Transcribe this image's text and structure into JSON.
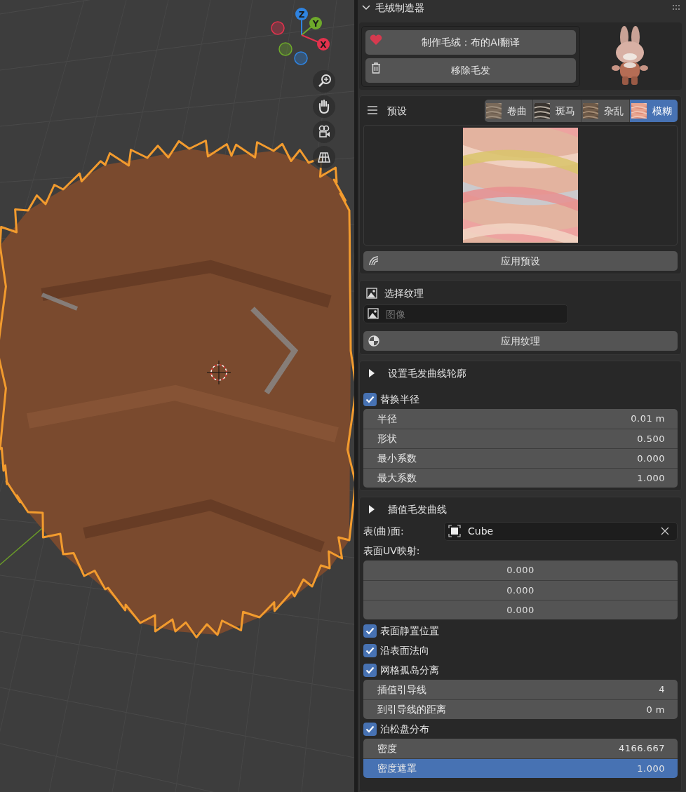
{
  "viewport": {
    "axes": [
      {
        "label": "Z",
        "kind": "z"
      },
      {
        "label": "Y",
        "kind": "y"
      },
      {
        "label": "X",
        "kind": "x"
      }
    ]
  },
  "panel": {
    "title": "毛绒制造器",
    "expanded": true
  },
  "actions": [
    {
      "label": "制作毛绒：布的AI翻译"
    },
    {
      "label": "移除毛发"
    }
  ],
  "presets": {
    "label": "预设",
    "tabs": [
      {
        "label": "卷曲",
        "selected": false
      },
      {
        "label": "斑马",
        "selected": false
      },
      {
        "label": "杂乱",
        "selected": false
      },
      {
        "label": "模糊",
        "selected": true
      }
    ],
    "apply_label": "应用预设"
  },
  "texture": {
    "label": "选择纹理",
    "image_placeholder": "图像",
    "apply_label": "应用纹理"
  },
  "profile": {
    "title": "设置毛发曲线轮廓",
    "expanded": false,
    "replace_radius": {
      "label": "替换半径",
      "checked": true
    },
    "fields": [
      {
        "label": "半径",
        "value": "0.01 m",
        "selected": false
      },
      {
        "label": "形状",
        "value": "0.500",
        "selected": false
      },
      {
        "label": "最小系数",
        "value": "0.000",
        "selected": false
      },
      {
        "label": "最大系数",
        "value": "1.000",
        "selected": false
      }
    ]
  },
  "interpolate": {
    "title": "插值毛发曲线",
    "expanded": false,
    "surface_label": "表(曲)面:",
    "surface_value": "Cube",
    "uv_label": "表面UV映射:",
    "uv_values": [
      "0.000",
      "0.000",
      "0.000"
    ],
    "options": [
      {
        "kind": "checkbox",
        "label": "表面静置位置",
        "checked": true
      },
      {
        "kind": "checkbox",
        "label": "沿表面法向",
        "checked": true
      },
      {
        "kind": "checkbox",
        "label": "网格孤岛分离",
        "checked": true
      },
      {
        "kind": "fields",
        "fields": [
          {
            "label": "插值引导线",
            "value": "4",
            "selected": false
          },
          {
            "label": "到引导线的距离",
            "value": "0 m",
            "selected": false
          }
        ]
      },
      {
        "kind": "checkbox",
        "label": "泊松盘分布",
        "checked": true
      },
      {
        "kind": "fields",
        "fields": [
          {
            "label": "密度",
            "value": "4166.667",
            "selected": false
          },
          {
            "label": "密度遮罩",
            "value": "1.000",
            "selected": true
          }
        ]
      }
    ]
  }
}
